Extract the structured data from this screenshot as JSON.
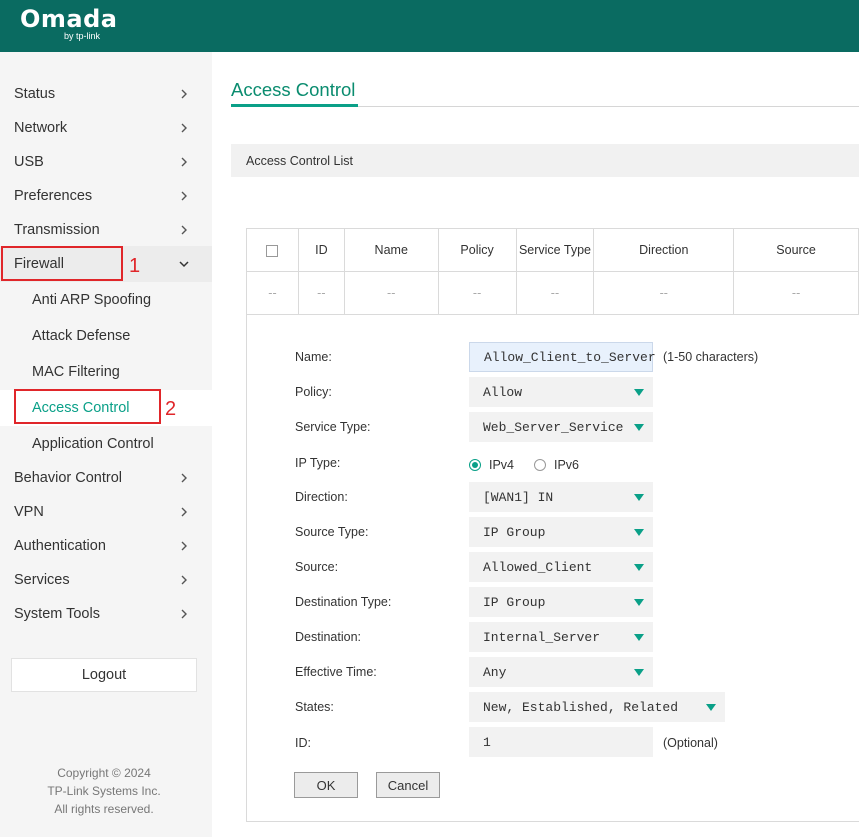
{
  "header": {
    "logo_main": "Omada",
    "logo_sub": "by tp-link"
  },
  "sidebar": {
    "items": [
      {
        "label": "Status"
      },
      {
        "label": "Network"
      },
      {
        "label": "USB"
      },
      {
        "label": "Preferences"
      },
      {
        "label": "Transmission"
      },
      {
        "label": "Firewall"
      },
      {
        "label": "Behavior Control"
      },
      {
        "label": "VPN"
      },
      {
        "label": "Authentication"
      },
      {
        "label": "Services"
      },
      {
        "label": "System Tools"
      }
    ],
    "firewall_sub": [
      {
        "label": "Anti ARP Spoofing"
      },
      {
        "label": "Attack Defense"
      },
      {
        "label": "MAC Filtering"
      },
      {
        "label": "Access Control"
      },
      {
        "label": "Application Control"
      }
    ],
    "annotations": {
      "firewall_number": "1",
      "access_control_number": "2"
    },
    "logout_label": "Logout",
    "copyright": {
      "line1": "Copyright © 2024",
      "line2": "TP-Link Systems Inc.",
      "line3": "All rights reserved."
    }
  },
  "main": {
    "title": "Access Control",
    "list_title": "Access Control List",
    "table": {
      "headers": [
        "ID",
        "Name",
        "Policy",
        "Service Type",
        "Direction",
        "Source"
      ],
      "empty_cell": "--"
    },
    "form": {
      "name_label": "Name:",
      "name_value": "Allow_Client_to_Server",
      "name_hint": "(1-50 characters)",
      "policy_label": "Policy:",
      "policy_value": "Allow",
      "service_type_label": "Service Type:",
      "service_type_value": "Web_Server_Service",
      "ip_type_label": "IP Type:",
      "ip_type_options": [
        "IPv4",
        "IPv6"
      ],
      "ip_type_selected": "IPv4",
      "direction_label": "Direction:",
      "direction_value": "[WAN1] IN",
      "source_type_label": "Source Type:",
      "source_type_value": "IP Group",
      "source_label": "Source:",
      "source_value": "Allowed_Client",
      "destination_type_label": "Destination Type:",
      "destination_type_value": "IP Group",
      "destination_label": "Destination:",
      "destination_value": "Internal_Server",
      "effective_time_label": "Effective Time:",
      "effective_time_value": "Any",
      "states_label": "States:",
      "states_value": "New, Established, Related",
      "id_label": "ID:",
      "id_value": "1",
      "id_hint": "(Optional)",
      "ok_label": "OK",
      "cancel_label": "Cancel"
    }
  },
  "colors": {
    "header": "#0a6b61",
    "accent": "#0aa088",
    "annotation": "#e0262a"
  }
}
